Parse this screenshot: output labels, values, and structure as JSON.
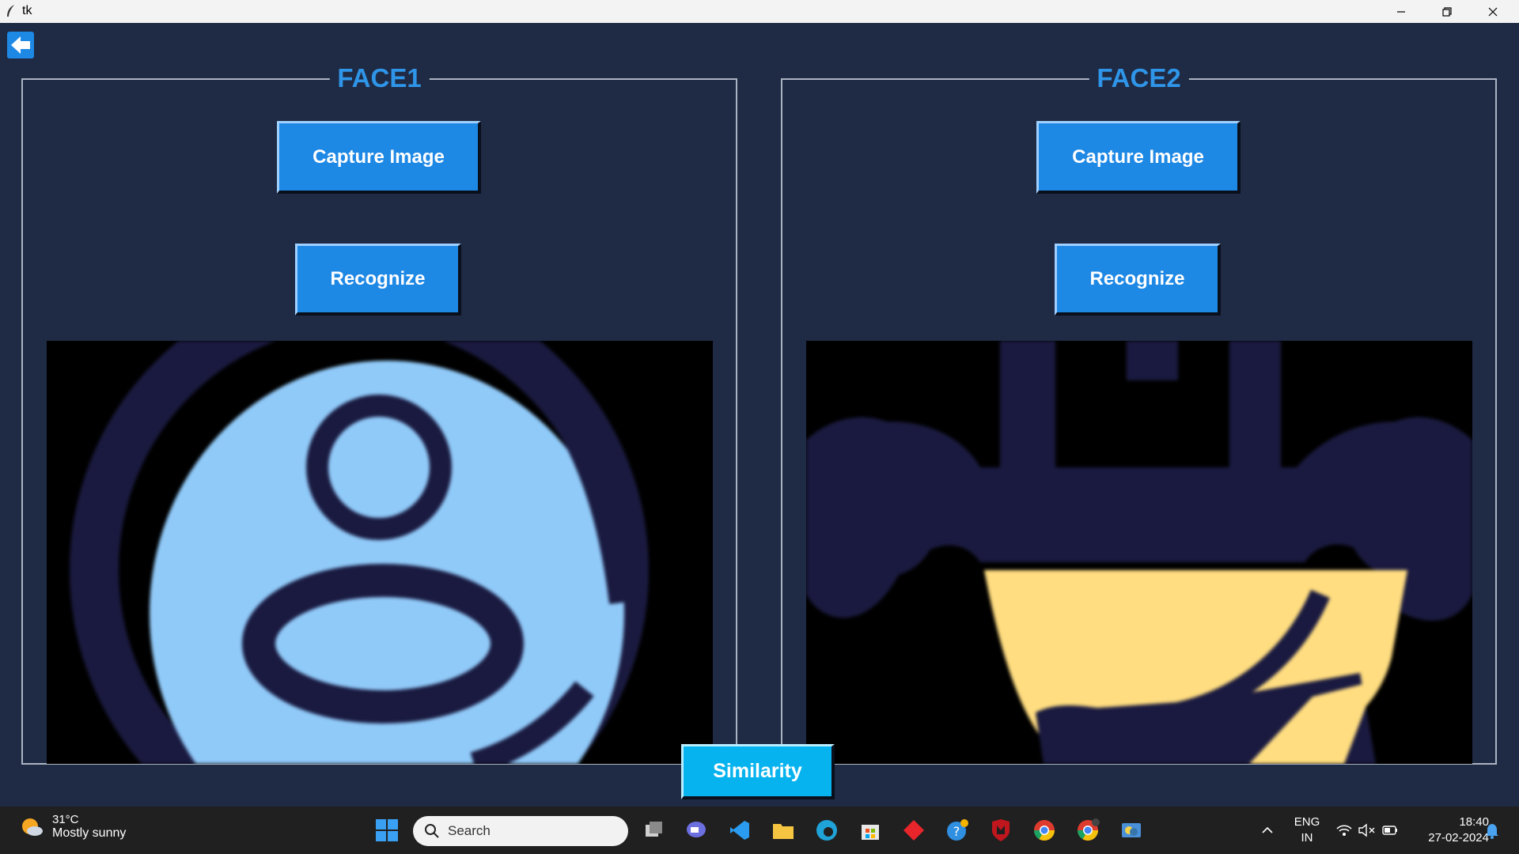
{
  "window": {
    "title": "tk"
  },
  "panels": [
    {
      "title": "FACE1",
      "capture_label": "Capture Image",
      "recognize_label": "Recognize"
    },
    {
      "title": "FACE2",
      "capture_label": "Capture Image",
      "recognize_label": "Recognize"
    }
  ],
  "similarity_label": "Similarity",
  "colors": {
    "background": "#1f2a44",
    "button_blue": "#1e88e5",
    "similarity_cyan": "#07b3ee",
    "title_blue": "#2f95e8",
    "face1_light": "#90caf9",
    "face2_yellow": "#ffdd80",
    "dark_navy": "#1a1a40"
  },
  "taskbar": {
    "weather_temp": "31°C",
    "weather_desc": "Mostly sunny",
    "search_placeholder": "Search",
    "lang_top": "ENG",
    "lang_bottom": "IN",
    "time": "18:40",
    "date": "27-02-2024"
  }
}
